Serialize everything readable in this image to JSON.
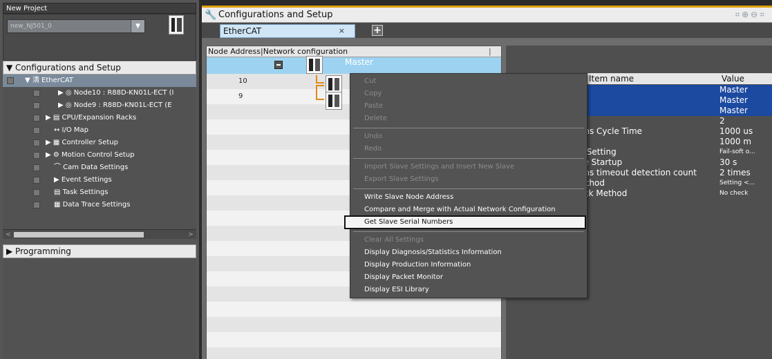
{
  "window": {
    "title": "New Project"
  },
  "device": {
    "name": "new_NJ501_0"
  },
  "tree": {
    "root": "▼ Configurations and Setup",
    "items": [
      {
        "label": "▼ 淸 EtherCAT",
        "level": 1
      },
      {
        "label": "▶ ◎ Node10 : R88D-KN01L-ECT (I",
        "level": 2
      },
      {
        "label": "▶ ◎ Node9 : R88D-KN01L-ECT (E",
        "level": 2
      },
      {
        "label": "▶ ▤ CPU/Expansion Racks",
        "level": 1
      },
      {
        "label": "↔ I/O Map",
        "level": 1
      },
      {
        "label": "▶ ▦ Controller Setup",
        "level": 1
      },
      {
        "label": "▶ ⚙ Motion Control Setup",
        "level": 1
      },
      {
        "label": "⌒ Cam Data Settings",
        "level": 1
      },
      {
        "label": "▶ Event Settings",
        "level": 1
      },
      {
        "label": "▤ Task Settings",
        "level": 1
      },
      {
        "label": "▦ Data Trace Settings",
        "level": 1
      }
    ],
    "programming": "▶ Programming"
  },
  "main": {
    "title": "Configurations and Setup",
    "tab": {
      "label": "EtherCAT",
      "close": "×",
      "add": "+"
    }
  },
  "grid": {
    "header": "Node Address|Network configuration",
    "master_label": "Master",
    "rows": [
      {
        "address": "10"
      },
      {
        "address": "9"
      }
    ]
  },
  "props": {
    "header_item": "Item name",
    "header_value": "Value",
    "rows": [
      {
        "name": "",
        "value": "Master"
      },
      {
        "name": "",
        "value": "Master"
      },
      {
        "name": "",
        "value": "Master"
      },
      {
        "name": "s",
        "value": "2"
      },
      {
        "name": "tions Cycle Time",
        "value": "1000   us"
      },
      {
        "name": "gth",
        "value": "1000    m"
      },
      {
        "name": "on Setting",
        "value": "Fail-soft o..."
      },
      {
        "name": "ave Startup",
        "value": "30        s"
      },
      {
        "name": "tions timeout detection count",
        "value": "2   times"
      },
      {
        "name": "Method",
        "value": "Setting <..."
      },
      {
        "name": "heck Method",
        "value": "No check"
      }
    ]
  },
  "context_menu": {
    "items": [
      {
        "label": "Cut",
        "enabled": false
      },
      {
        "label": "Copy",
        "enabled": false
      },
      {
        "label": "Paste",
        "enabled": false
      },
      {
        "label": "Delete",
        "enabled": false
      },
      {
        "label": "Undo",
        "enabled": false
      },
      {
        "label": "Redo",
        "enabled": false
      },
      {
        "label": "Import Slave Settings and Insert New Slave",
        "enabled": false
      },
      {
        "label": "Export Slave Settings",
        "enabled": false
      },
      {
        "label": "Write Slave Node Address",
        "enabled": true
      },
      {
        "label": "Compare and Merge with Actual Network Configuration",
        "enabled": true
      },
      {
        "label": "Get Slave Serial Numbers",
        "enabled": true
      },
      {
        "label": "Clear All Settings",
        "enabled": false
      },
      {
        "label": "Display Diagnosis/Statistics Information",
        "enabled": true
      },
      {
        "label": "Display Production Information",
        "enabled": true
      },
      {
        "label": "Display Packet Monitor",
        "enabled": true
      },
      {
        "label": "Display ESI Library",
        "enabled": true
      }
    ]
  },
  "colors": {
    "accent": "#e0a000",
    "selection": "#1c4aa0",
    "master_row": "#9dd3f1",
    "connector": "#e08a18"
  },
  "icons": {
    "main_title": "wrench-icon",
    "tools": "zoom-fit-icon"
  }
}
